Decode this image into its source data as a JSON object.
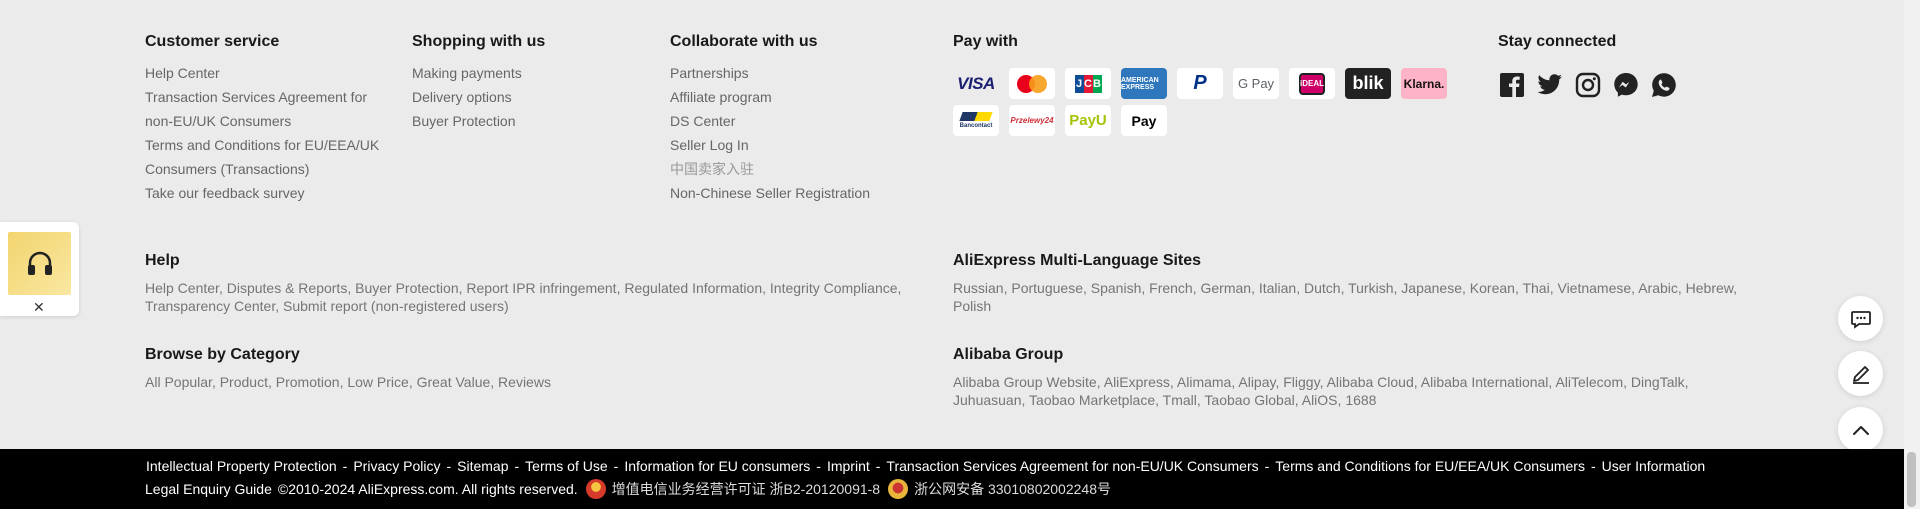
{
  "customer_service": {
    "title": "Customer service",
    "links": [
      "Help Center",
      "Transaction Services Agreement for",
      "non-EU/UK Consumers",
      "Terms and Conditions for EU/EEA/UK",
      "Consumers (Transactions)",
      "Take our feedback survey"
    ]
  },
  "shopping": {
    "title": "Shopping with us",
    "links": [
      "Making payments",
      "Delivery options",
      "Buyer Protection"
    ]
  },
  "collaborate": {
    "title": "Collaborate with us",
    "links": [
      "Partnerships",
      "Affiliate program",
      "DS Center",
      "Seller Log In",
      "中国卖家入驻",
      "Non-Chinese Seller Registration"
    ]
  },
  "pay": {
    "title": "Pay with",
    "methods": {
      "visa": "VISA",
      "mastercard": "mastercard",
      "jcb": [
        "J",
        "C",
        "B"
      ],
      "amex": "AMERICAN EXPRESS",
      "paypal": "P",
      "gpay": "G Pay",
      "ideal": "iDEAL",
      "blik": "blik",
      "klarna": "Klarna.",
      "bancontact": "Bancontact",
      "przelewy": "Przelewy24",
      "payu": "PayU",
      "applepay": " Pay"
    }
  },
  "stay": {
    "title": "Stay connected",
    "icons": [
      "facebook-icon",
      "twitter-icon",
      "instagram-icon",
      "messenger-icon",
      "whatsapp-icon"
    ]
  },
  "help": {
    "title": "Help",
    "items": [
      "Help Center",
      "Disputes & Reports",
      "Buyer Protection",
      "Report IPR infringement",
      "Regulated Information",
      "Integrity Compliance",
      "Transparency Center",
      "Submit report (non-registered users)"
    ]
  },
  "multi_language": {
    "title": "AliExpress Multi-Language Sites",
    "items": [
      "Russian",
      "Portuguese",
      "Spanish",
      "French",
      "German",
      "Italian",
      "Dutch",
      "Turkish",
      "Japanese",
      "Korean",
      "Thai",
      "Vietnamese",
      "Arabic",
      "Hebrew",
      "Polish"
    ]
  },
  "browse": {
    "title": "Browse by Category",
    "items": [
      "All Popular",
      "Product",
      "Promotion",
      "Low Price",
      "Great Value",
      "Reviews"
    ]
  },
  "alibaba": {
    "title": "Alibaba Group",
    "items": [
      "Alibaba Group Website",
      "AliExpress",
      "Alimama",
      "Alipay",
      "Fliggy",
      "Alibaba Cloud",
      "Alibaba International",
      "AliTelecom",
      "DingTalk",
      "Juhuasuan",
      "Taobao Marketplace",
      "Tmall",
      "Taobao Global",
      "AliOS",
      "1688"
    ]
  },
  "bottom": {
    "links": [
      "Intellectual Property Protection",
      "Privacy Policy",
      "Sitemap",
      "Terms of Use",
      "Information for EU consumers",
      "Imprint",
      "Transaction Services Agreement for non-EU/UK Consumers",
      "Terms and Conditions for EU/EEA/UK Consumers",
      "User Information"
    ],
    "separator": "-",
    "legal_enquiry": "Legal Enquiry Guide",
    "copyright": "©2010-2024 AliExpress.com. All rights reserved.",
    "icp": "增值电信业务经营许可证 浙B2-20120091-8",
    "police": "浙公网安备 33010802002248号"
  },
  "floating": {
    "close_label": "✕",
    "thumb_icon": "headphones-icon"
  },
  "side_buttons": [
    "chat-icon",
    "edit-icon",
    "arrow-up-icon"
  ]
}
